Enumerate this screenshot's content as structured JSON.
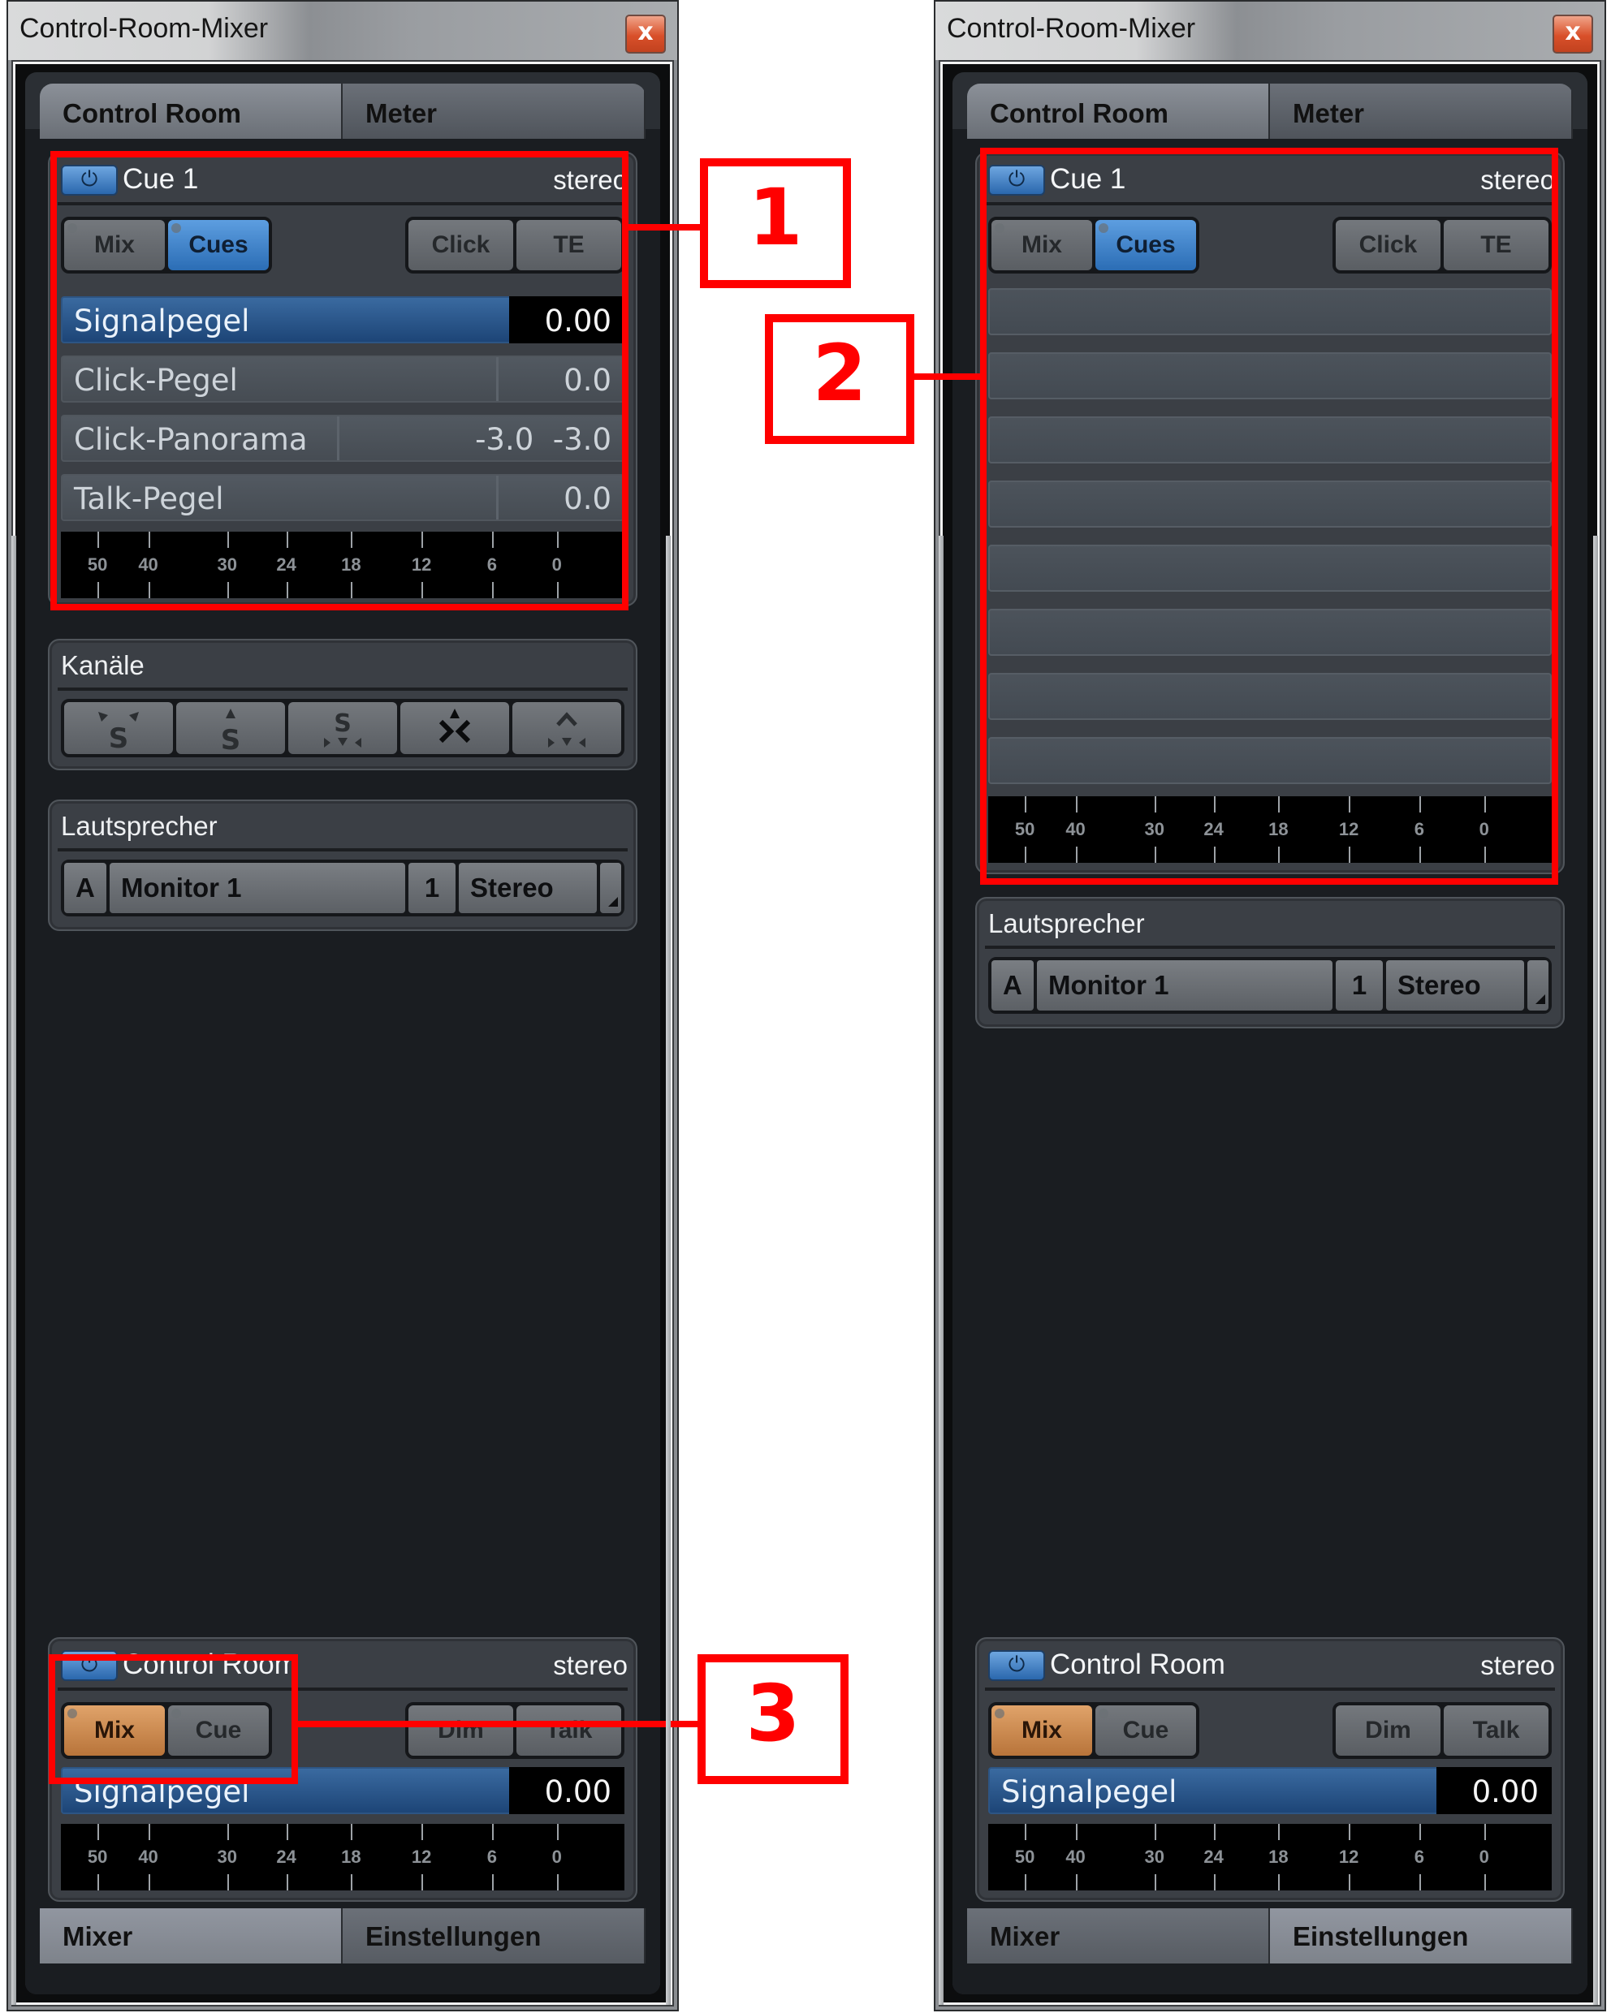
{
  "windows": [
    {
      "id": "left",
      "title": "Control-Room-Mixer",
      "close_label": "x",
      "top_tabs": [
        {
          "label": "Control Room",
          "active": true
        },
        {
          "label": "Meter",
          "active": false
        }
      ],
      "cue": {
        "name": "Cue 1",
        "format": "stereo",
        "source_buttons": [
          {
            "label": "Mix",
            "active": false
          },
          {
            "label": "Cues",
            "active": true
          }
        ],
        "option_buttons": [
          {
            "label": "Click",
            "active": false
          },
          {
            "label": "TE",
            "active": false
          }
        ],
        "mode": "params",
        "sliders": [
          {
            "label": "Signalpegel",
            "value": "0.00",
            "active": true
          },
          {
            "label": "Click-Pegel",
            "value": "0.0",
            "active": false
          },
          {
            "label": "Click-Panorama",
            "value": "-3.0  -3.0",
            "active": false,
            "pan": true
          },
          {
            "label": "Talk-Pegel",
            "value": "0.0",
            "active": false
          }
        ]
      },
      "channels": {
        "title": "Kanäle",
        "buttons": [
          {
            "icon": "downmix-surround-icon"
          },
          {
            "icon": "downmix-front-icon"
          },
          {
            "icon": "downmix-rear-icon"
          },
          {
            "icon": "downmix-center-icon"
          },
          {
            "icon": "downmix-lfe-icon"
          }
        ]
      },
      "speakers": {
        "title": "Lautsprecher",
        "slot": "A",
        "name": "Monitor 1",
        "number": "1",
        "config": "Stereo"
      },
      "control_room": {
        "name": "Control Room",
        "format": "stereo",
        "source_buttons": [
          {
            "label": "Mix",
            "active": true
          },
          {
            "label": "Cue",
            "active": false
          }
        ],
        "option_buttons": [
          {
            "label": "Dim",
            "active": false
          },
          {
            "label": "Talk",
            "active": false
          }
        ],
        "slider": {
          "label": "Signalpegel",
          "value": "0.00"
        }
      },
      "bottom_tabs": [
        {
          "label": "Mixer",
          "active": true
        },
        {
          "label": "Einstellungen",
          "active": false
        }
      ]
    },
    {
      "id": "right",
      "title": "Control-Room-Mixer",
      "close_label": "x",
      "top_tabs": [
        {
          "label": "Control Room",
          "active": true
        },
        {
          "label": "Meter",
          "active": false
        }
      ],
      "cue": {
        "name": "Cue 1",
        "format": "stereo",
        "source_buttons": [
          {
            "label": "Mix",
            "active": false
          },
          {
            "label": "Cues",
            "active": true
          }
        ],
        "option_buttons": [
          {
            "label": "Click",
            "active": false
          },
          {
            "label": "TE",
            "active": false
          }
        ],
        "mode": "empty",
        "empty_rows": 8
      },
      "speakers": {
        "title": "Lautsprecher",
        "slot": "A",
        "name": "Monitor 1",
        "number": "1",
        "config": "Stereo"
      },
      "control_room": {
        "name": "Control Room",
        "format": "stereo",
        "source_buttons": [
          {
            "label": "Mix",
            "active": true
          },
          {
            "label": "Cue",
            "active": false
          }
        ],
        "option_buttons": [
          {
            "label": "Dim",
            "active": false
          },
          {
            "label": "Talk",
            "active": false
          }
        ],
        "slider": {
          "label": "Signalpegel",
          "value": "0.00"
        }
      },
      "bottom_tabs": [
        {
          "label": "Mixer",
          "active": false
        },
        {
          "label": "Einstellungen",
          "active": true
        }
      ]
    }
  ],
  "meter_scale": [
    "50",
    "40",
    "30",
    "24",
    "18",
    "12",
    "6",
    "0"
  ],
  "callouts": [
    {
      "number": "1"
    },
    {
      "number": "2"
    },
    {
      "number": "3"
    }
  ],
  "colors": {
    "callout": "#ff0000",
    "active_blue": "#2b6db5",
    "active_orange": "#b8743a"
  }
}
